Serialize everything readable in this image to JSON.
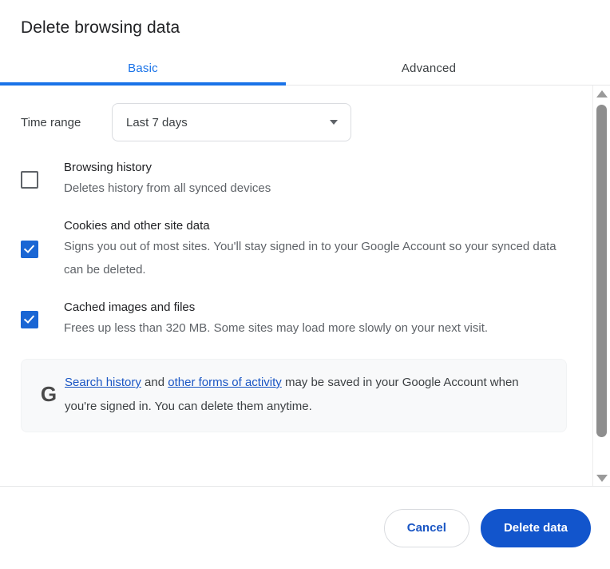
{
  "dialog": {
    "title": "Delete browsing data"
  },
  "tabs": [
    {
      "label": "Basic",
      "active": true
    },
    {
      "label": "Advanced",
      "active": false
    }
  ],
  "time_range": {
    "label": "Time range",
    "selected": "Last 7 days",
    "arrow_icon": "chevron-down-icon"
  },
  "options": [
    {
      "title": "Browsing history",
      "description": "Deletes history from all synced devices",
      "checked": false
    },
    {
      "title": "Cookies and other site data",
      "description": "Signs you out of most sites. You'll stay signed in to your Google Account so your synced data can be deleted.",
      "checked": true
    },
    {
      "title": "Cached images and files",
      "description": "Frees up less than 320 MB. Some sites may load more slowly on your next visit.",
      "checked": true
    }
  ],
  "info_card": {
    "logo": "google-g-logo",
    "link1": "Search history",
    "mid_text": " and ",
    "link2": "other forms of activity",
    "tail_text": " may be saved in your Google Account when you're signed in. You can delete them anytime."
  },
  "footer": {
    "cancel_label": "Cancel",
    "delete_label": "Delete data"
  },
  "scrollbar": {
    "up_icon": "scroll-up-arrow-icon",
    "down_icon": "scroll-down-arrow-icon"
  },
  "colors": {
    "accent_blue": "#1a73e8",
    "checkbox_blue": "#1a66d4",
    "primary_button": "#1255cc",
    "link_blue": "#1a56c4",
    "title_text": "#202124",
    "secondary_text": "#5f6368",
    "card_bg": "#f8f9fa"
  }
}
